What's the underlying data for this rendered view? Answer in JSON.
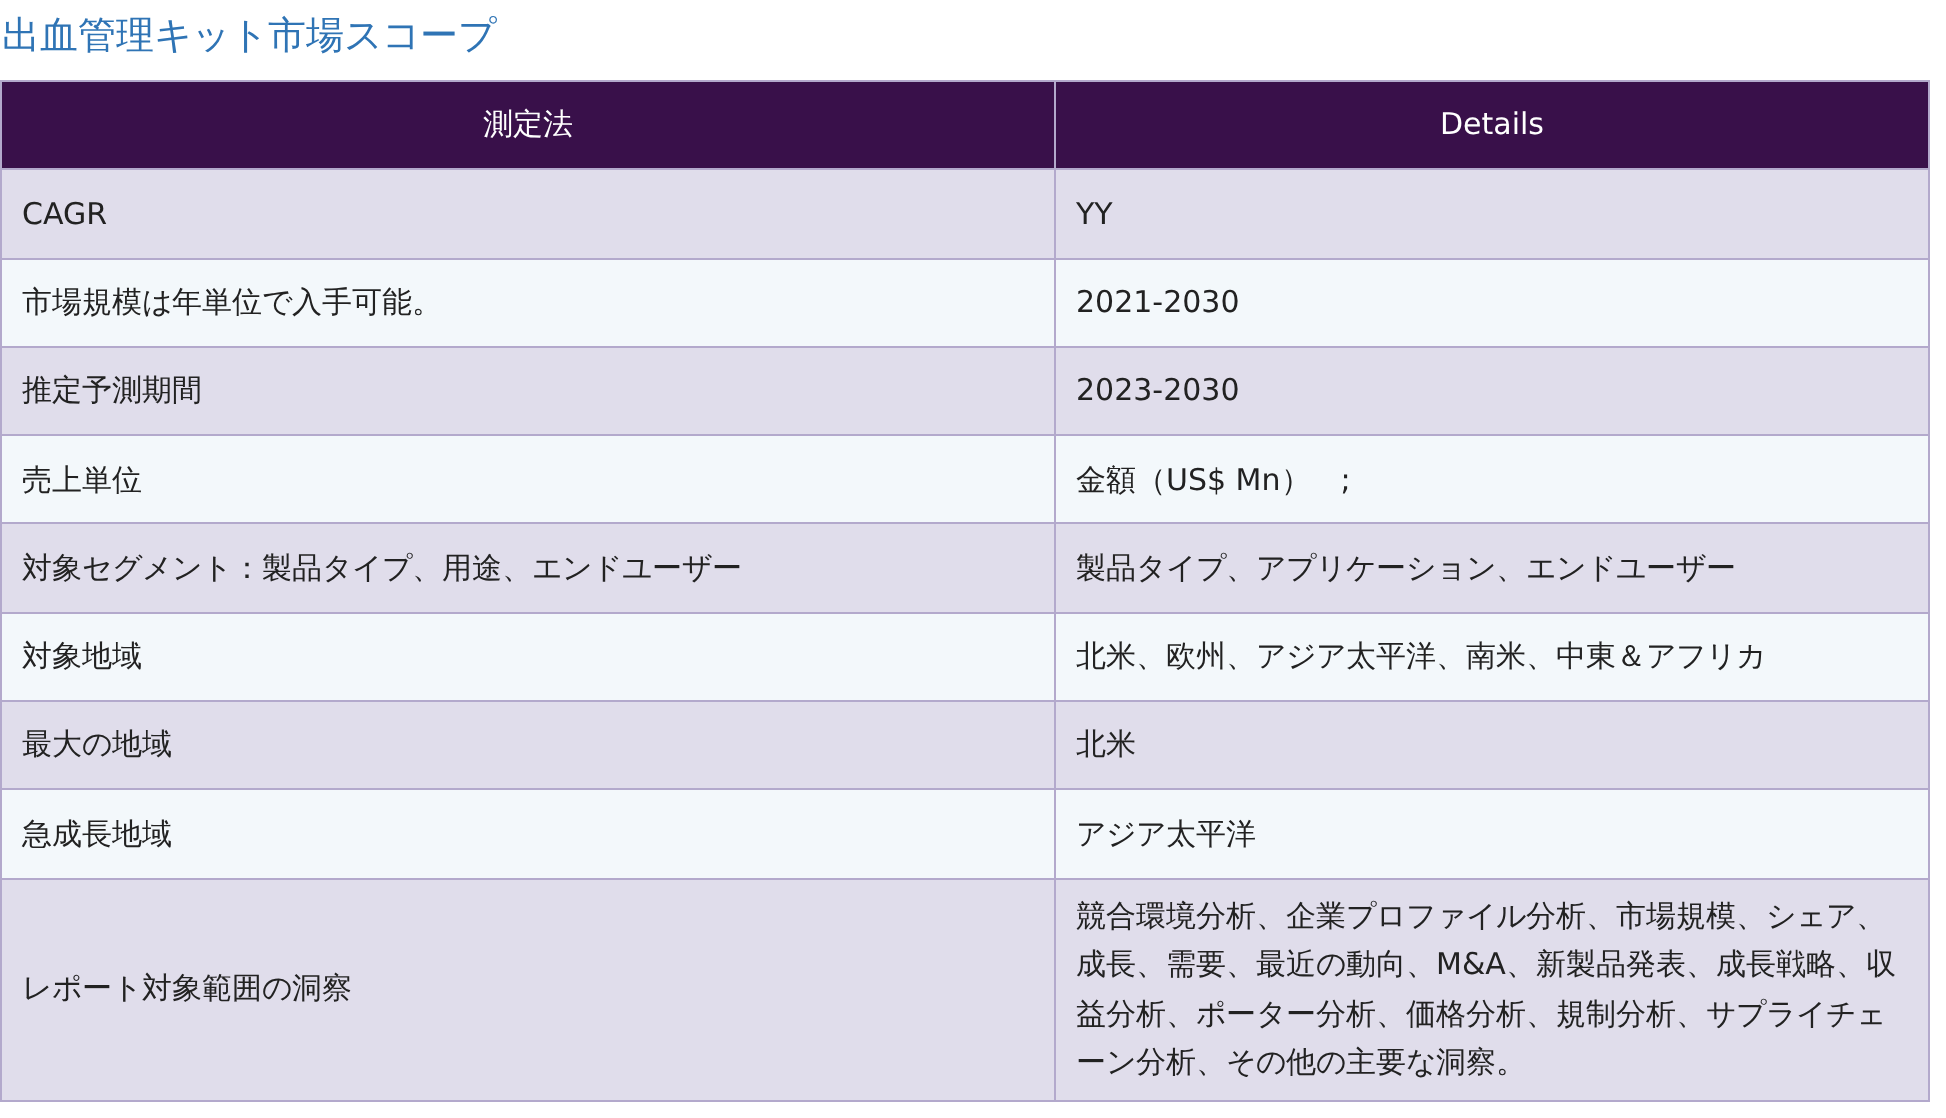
{
  "title": "出血管理キット市場スコープ",
  "table": {
    "columns": [
      "測定法",
      "Details"
    ],
    "rows": [
      [
        "CAGR",
        "YY"
      ],
      [
        "市場規模は年単位で入手可能。",
        "2021-2030"
      ],
      [
        "推定予測期間",
        "2023-2030"
      ],
      [
        "売上単位",
        "金額（US$ Mn）　;"
      ],
      [
        "対象セグメント：製品タイプ、用途、エンドユーザー",
        "製品タイプ、アプリケーション、エンドユーザー"
      ],
      [
        "対象地域",
        "北米、欧州、アジア太平洋、南米、中東＆アフリカ"
      ],
      [
        "最大の地域",
        "北米"
      ],
      [
        "急成長地域",
        "アジア太平洋"
      ],
      [
        "レポート対象範囲の洞察",
        "競合環境分析、企業プロファイル分析、市場規模、シェア、成長、需要、最近の動向、M&A、新製品発表、成長戦略、収益分析、ポーター分析、価格分析、規制分析、サプライチェーン分析、その他の主要な洞察。"
      ]
    ]
  }
}
